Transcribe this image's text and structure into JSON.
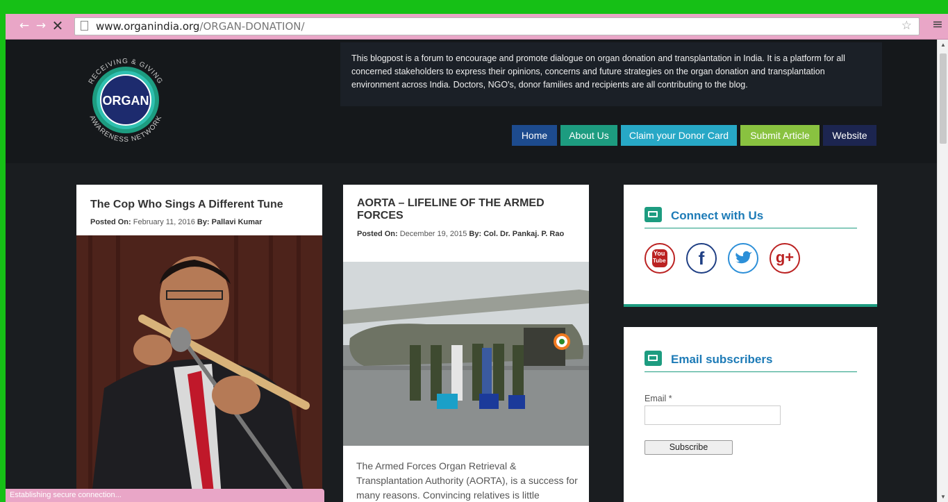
{
  "browser": {
    "url_host": "www.organindia.org",
    "url_path": "/ORGAN-DONATION/",
    "status_text": "Establishing secure connection..."
  },
  "logo": {
    "main": "ORGAN",
    "ring_top": "RECEIVING & GIVING",
    "ring_left": "ORGAN",
    "ring_bottom": "AWARENESS NETWORK"
  },
  "site": {
    "description": "This blogpost is a forum to encourage and promote dialogue on organ donation and transplantation in India. It is a platform for all concerned stakeholders to express their opinions, concerns and future strategies on the organ donation and transplantation environment across India. Doctors, NGO's, donor families and recipients are all contributing to the blog."
  },
  "nav": {
    "home": "Home",
    "about": "About Us",
    "claim": "Claim your Donor Card",
    "submit": "Submit Article",
    "website": "Website"
  },
  "posts": [
    {
      "title": "The Cop Who Sings A Different Tune",
      "posted_label": "Posted On:",
      "date": "February 11, 2016",
      "by_label": "By:",
      "author": "Pallavi Kumar"
    },
    {
      "title": "AORTA – LIFELINE OF THE ARMED FORCES",
      "posted_label": "Posted On:",
      "date": "December 19, 2015",
      "by_label": "By:",
      "author": "Col. Dr. Pankaj. P. Rao",
      "excerpt": "The Armed Forces Organ Retrieval & Transplantation Authority (AORTA), is a success for many reasons. Convincing relatives is little"
    }
  ],
  "widgets": {
    "connect_title": "Connect with Us",
    "social": {
      "youtube_top": "You",
      "youtube_bottom": "Tube",
      "facebook": "f",
      "gplus": "g+"
    },
    "email_title": "Email subscribers",
    "email_label": "Email *",
    "subscribe_button": "Subscribe"
  },
  "colors": {
    "accent_teal": "#1d9c80",
    "link_blue": "#1d7bb7",
    "chrome_pink": "#e9a6c7"
  }
}
